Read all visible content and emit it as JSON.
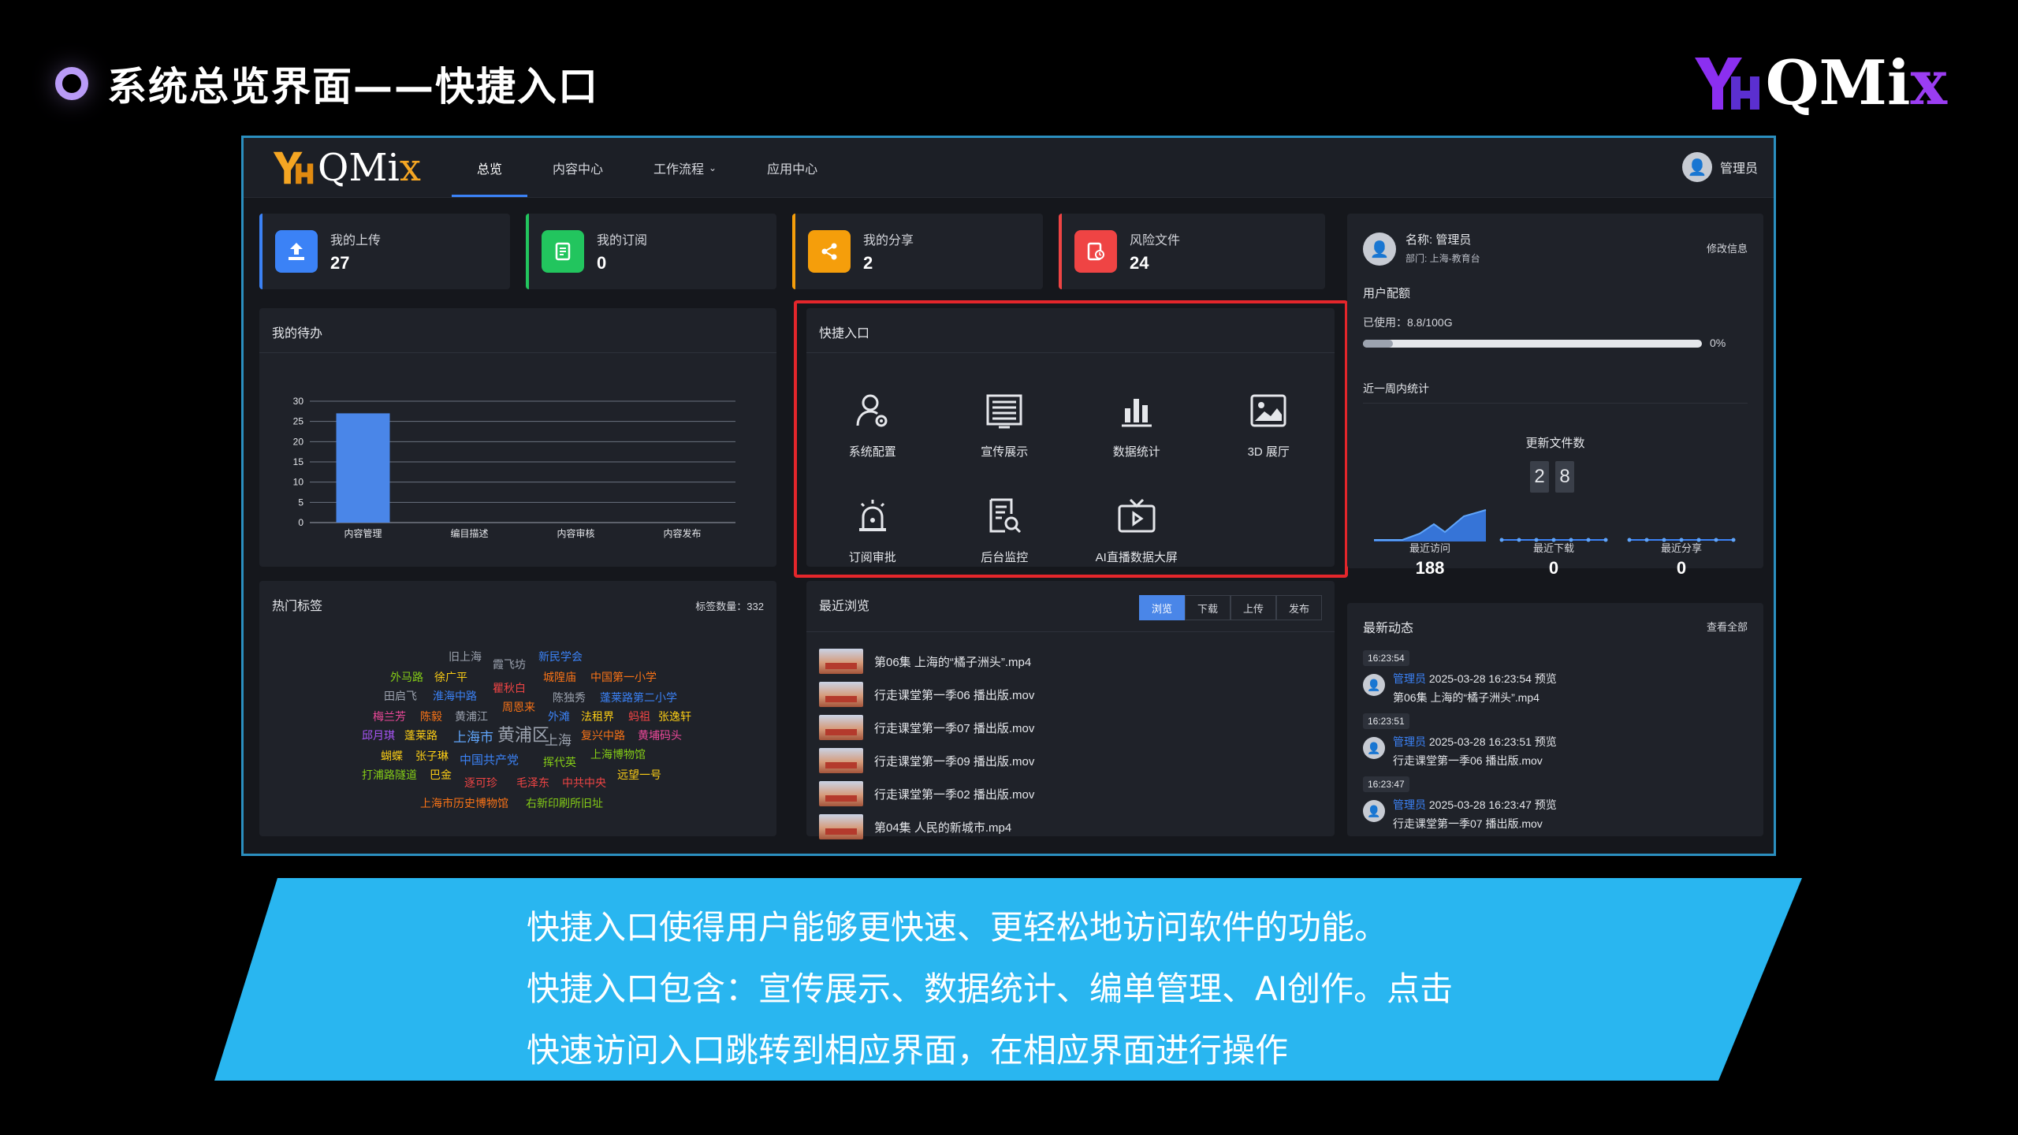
{
  "slide": {
    "title": "系统总览界面——快捷入口",
    "logo_text": "QMi",
    "logo_x": "x"
  },
  "app": {
    "logo_text": "QMi",
    "logo_x": "x",
    "nav": [
      {
        "label": "总览",
        "active": true
      },
      {
        "label": "内容中心"
      },
      {
        "label": "工作流程",
        "has_dropdown": true
      },
      {
        "label": "应用中心"
      }
    ],
    "user": "管理员",
    "stats": [
      {
        "label": "我的上传",
        "value": "27",
        "color": "#3b82f6"
      },
      {
        "label": "我的订阅",
        "value": "0",
        "color": "#22c55e"
      },
      {
        "label": "我的分享",
        "value": "2",
        "color": "#f59e0b"
      },
      {
        "label": "风险文件",
        "value": "24",
        "color": "#ef4444"
      }
    ],
    "todo": {
      "title": "我的待办"
    },
    "quick": {
      "title": "快捷入口",
      "items": [
        {
          "label": "系统配置",
          "icon": "user-settings-icon"
        },
        {
          "label": "宣传展示",
          "icon": "news-icon"
        },
        {
          "label": "数据统计",
          "icon": "bar-chart-icon"
        },
        {
          "label": "3D 展厅",
          "icon": "image-icon"
        },
        {
          "label": "订阅审批",
          "icon": "alarm-icon"
        },
        {
          "label": "后台监控",
          "icon": "document-search-icon"
        },
        {
          "label": "AI直播数据大屏",
          "icon": "tv-play-icon"
        }
      ]
    },
    "profile": {
      "name": "名称: 管理员",
      "dept": "部门: 上海-教育台",
      "edit": "修改信息",
      "quota_title": "用户配额",
      "used": "已使用：8.8/100G",
      "percent": "0%",
      "quota_fraction": 0.088,
      "week_title": "近一周内统计",
      "updated_title": "更新文件数",
      "updated_digits": [
        "2",
        "8"
      ],
      "minis": [
        {
          "label": "最近访问",
          "value": "188"
        },
        {
          "label": "最近下载",
          "value": "0"
        },
        {
          "label": "最近分享",
          "value": "0"
        }
      ]
    },
    "tags": {
      "title": "热门标签",
      "count": "标签数量：332",
      "words": [
        "旧上海",
        "霞飞坊",
        "新民学会",
        "外马路",
        "徐广平",
        "城隍庙",
        "中国第一小学",
        "田启飞",
        "淮海中路",
        "瞿秋白",
        "陈独秀",
        "蓬莱路第二小学",
        "周恩来",
        "梅兰芳",
        "陈毅",
        "黄浦江",
        "外滩",
        "法租界",
        "蚂祖",
        "张逸轩",
        "邱月琪",
        "蓬莱路",
        "上海市",
        "黄浦区",
        "上海",
        "复兴中路",
        "黄埔码头",
        "蝴蝶",
        "张子琳",
        "中国共产党",
        "上海博物馆",
        "挥代英",
        "打浦路隧道",
        "巴金",
        "逐可珍",
        "毛泽东",
        "中共中央",
        "远望一号",
        "上海市历史博物馆",
        "右新印刷所旧址"
      ]
    },
    "recent": {
      "title": "最近浏览",
      "tabs": [
        "浏览",
        "下载",
        "上传",
        "发布"
      ],
      "items": [
        "第06集 上海的“橘子洲头”.mp4",
        "行走课堂第一季06 播出版.mov",
        "行走课堂第一季07 播出版.mov",
        "行走课堂第一季09 播出版.mov",
        "行走课堂第一季02 播出版.mov",
        "第04集 人民的新城市.mp4"
      ]
    },
    "activity": {
      "title": "最新动态",
      "view_all": "查看全部",
      "items": [
        {
          "time": "16:23:54",
          "user": "管理员",
          "stamp": "2025-03-28 16:23:54 预览",
          "file": "第06集 上海的“橘子洲头”.mp4"
        },
        {
          "time": "16:23:51",
          "user": "管理员",
          "stamp": "2025-03-28 16:23:51 预览",
          "file": "行走课堂第一季06 播出版.mov"
        },
        {
          "time": "16:23:47",
          "user": "管理员",
          "stamp": "2025-03-28 16:23:47 预览",
          "file": "行走课堂第一季07 播出版.mov"
        }
      ]
    }
  },
  "chart_data": {
    "type": "bar",
    "categories": [
      "内容管理",
      "编目描述",
      "内容审核",
      "内容发布"
    ],
    "values": [
      27,
      0,
      0,
      0
    ],
    "ylim": [
      0,
      30
    ],
    "yticks": [
      0,
      5,
      10,
      15,
      20,
      25,
      30
    ],
    "color": "#4a86e8"
  },
  "banner": {
    "line1": "快捷入口使得用户能够更快速、更轻松地访问软件的功能。",
    "line2": "快捷入口包含：宣传展示、数据统计、编单管理、AI创作。点击",
    "line3": "快速访问入口跳转到相应界面，在相应界面进行操作",
    "color": "#29b6f0"
  }
}
